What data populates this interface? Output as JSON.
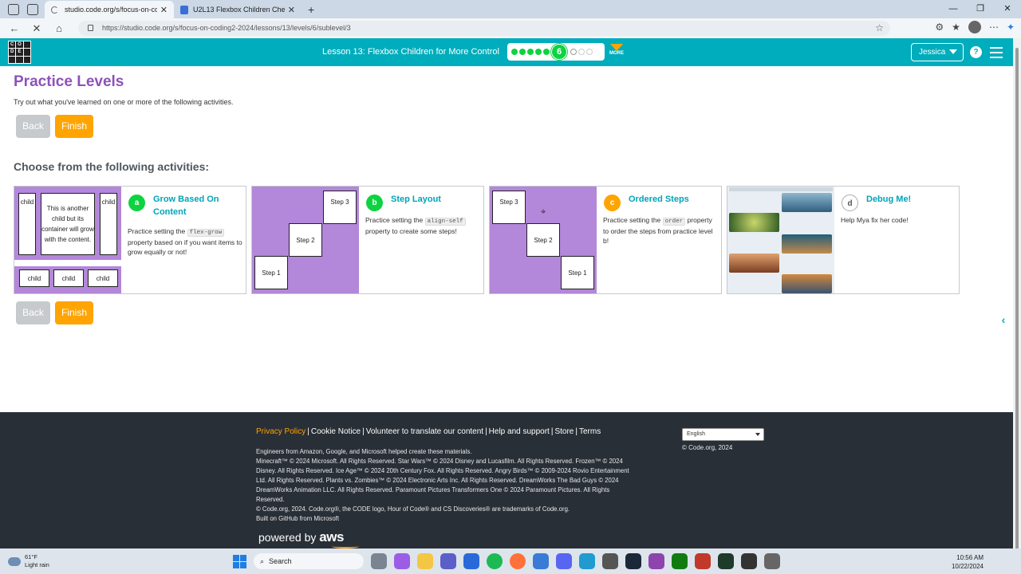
{
  "browser": {
    "tabs": [
      {
        "title": "studio.code.org/s/focus-on-codir",
        "active": true
      },
      {
        "title": "U2L13 Flexbox Children Cheat Sh",
        "active": false
      }
    ],
    "url": "https://studio.code.org/s/focus-on-coding2-2024/lessons/13/levels/6/sublevel/3"
  },
  "header": {
    "lesson_title": "Lesson 13: Flexbox Children for More Control",
    "current_level": "6",
    "more_label": "MORE",
    "user_name": "Jessica",
    "help_label": "?",
    "logo_letters": [
      "C",
      "O",
      "",
      "D",
      "E",
      "",
      "",
      "",
      ""
    ]
  },
  "main": {
    "title": "Practice Levels",
    "intro": "Try out what you've learned on one or more of the following activities.",
    "back_label": "Back",
    "finish_label": "Finish",
    "choose_heading": "Choose from the following activities:"
  },
  "activities": [
    {
      "letter": "a",
      "title": "Grow Based On Content",
      "desc_pre": "Practice setting the ",
      "code": "flex-grow",
      "desc_post": " property based on if you want items to grow equally or not!",
      "thumb": {
        "child": "child",
        "middle": "This is another child but its container will grow with the content."
      }
    },
    {
      "letter": "b",
      "title": "Step Layout",
      "desc_pre": "Practice setting the ",
      "code": "align-self",
      "desc_post": " property to create some steps!",
      "thumb": {
        "s1": "Step 1",
        "s2": "Step 2",
        "s3": "Step 3"
      }
    },
    {
      "letter": "c",
      "title": "Ordered Steps",
      "desc_pre": "Practice setting the ",
      "code": "order",
      "desc_post": " property to order the steps from practice level b!",
      "thumb": {
        "s1": "Step 1",
        "s2": "Step 2",
        "s3": "Step 3"
      }
    },
    {
      "letter": "d",
      "title": "Debug Me!",
      "desc": "Help Mya fix her code!"
    }
  ],
  "footer": {
    "links": [
      "Privacy Policy",
      "Cookie Notice",
      "Volunteer to translate our content",
      "Help and support",
      "Store",
      "Terms"
    ],
    "lines": [
      "Engineers from Amazon, Google, and Microsoft helped create these materials.",
      "Minecraft™ © 2024 Microsoft. All Rights Reserved. Star Wars™ © 2024 Disney and Lucasfilm. All Rights Reserved. Frozen™ © 2024 Disney. All Rights Reserved. Ice Age™ © 2024 20th Century Fox. All Rights Reserved. Angry Birds™ © 2009-2024 Rovio Entertainment Ltd. All Rights Reserved. Plants vs. Zombies™ © 2024 Electronic Arts Inc. All Rights Reserved. DreamWorks The Bad Guys © 2024 DreamWorks Animation LLC. All Rights Reserved. Paramount Pictures Transformers One © 2024 Paramount Pictures. All Rights Reserved.",
      "© Code.org, 2024. Code.org®, the CODE logo, Hour of Code® and CS Discoveries® are trademarks of Code.org.",
      "Built on GitHub from Microsoft"
    ],
    "language": "English",
    "copyright": "© Code.org, 2024",
    "powered_by": "powered by",
    "aws": "aws"
  },
  "taskbar": {
    "temp": "61°F",
    "weather": "Light rain",
    "search_placeholder": "Search",
    "time": "10:56 AM",
    "date": "10/22/2024"
  },
  "colors": {
    "teal": "#00adbc",
    "purple": "#8c52ba",
    "orange": "#ffa400",
    "green": "#0ed341"
  }
}
